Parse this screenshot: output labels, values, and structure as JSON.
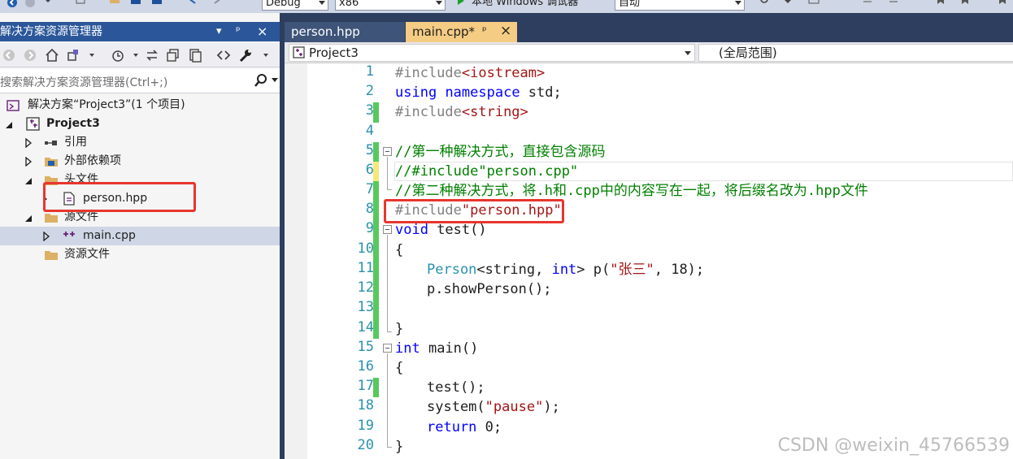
{
  "toolbar": {
    "config": "Debug",
    "platform": "x86",
    "run_label": "本地 Windows 调试器",
    "run_mode": "自动"
  },
  "solution_explorer": {
    "title": "解决方案资源管理器",
    "pin_glyphs": [
      "▾",
      "ᵖ",
      "×"
    ],
    "search_placeholder": "搜索解决方案资源管理器(Ctrl+;)",
    "tree": [
      {
        "label": "解决方案“Project3”(1 个项目)",
        "icon": "solution-icon",
        "expander": "none"
      },
      {
        "label": "Project3",
        "icon": "project-icon",
        "expander": "expanded",
        "bold": true
      },
      {
        "label": "引用",
        "icon": "references-icon",
        "expander": "collapsed"
      },
      {
        "label": "外部依赖项",
        "icon": "external-deps-icon",
        "expander": "collapsed"
      },
      {
        "label": "头文件",
        "icon": "folder-icon",
        "expander": "expanded"
      },
      {
        "label": "person.hpp",
        "icon": "header-file-icon",
        "expander": "collapsed"
      },
      {
        "label": "源文件",
        "icon": "folder-icon",
        "expander": "expanded"
      },
      {
        "label": "main.cpp",
        "icon": "cpp-file-icon",
        "expander": "collapsed",
        "selected": true
      },
      {
        "label": "资源文件",
        "icon": "folder-icon",
        "expander": "none"
      }
    ]
  },
  "editor": {
    "tabs": [
      {
        "label": "person.hpp",
        "active": false
      },
      {
        "label": "main.cpp*",
        "active": true,
        "pin": "ᵖ",
        "close": "×"
      }
    ],
    "nav": {
      "project": "Project3",
      "scope": "(全局范围)"
    },
    "line_numbers": [
      "1",
      "2",
      "3",
      "4",
      "5",
      "6",
      "7",
      "8",
      "9",
      "10",
      "11",
      "12",
      "13",
      "14",
      "15",
      "16",
      "17",
      "18",
      "19",
      "20"
    ],
    "code_text": {
      "l1_a": "#include",
      "l1_b": "<iostream>",
      "l2_a": "using",
      "l2_b": "namespace",
      "l2_c": " std;",
      "l3_a": "#include",
      "l3_b": "<string>",
      "l5": "//第一种解决方式，直接包含源码",
      "l6": "//#include\"person.cpp\"",
      "l7": "//第二种解决方式，将.h和.cpp中的内容写在一起，将后缀名改为.hpp文件",
      "l8_a": "#include",
      "l8_b": "\"person.hpp\"",
      "l9_a": "void",
      "l9_b": " test()",
      "l10": "{",
      "l11_a": "Person",
      "l11_b": "<",
      "l11_c": "string",
      "l11_d": ", ",
      "l11_e": "int",
      "l11_f": "> p(",
      "l11_g": "\"张三\"",
      "l11_h": ", 18);",
      "l12": "p.showPerson();",
      "l14": "}",
      "l15_a": "int",
      "l15_b": " main()",
      "l16": "{",
      "l17": "test();",
      "l18_a": "system(",
      "l18_b": "\"pause\"",
      "l18_c": ");",
      "l19_a": "return",
      "l19_b": " 0;",
      "l20": "}"
    }
  },
  "watermark": "CSDN @weixin_45766539",
  "colors": {
    "highlight_box": "#e8362e",
    "title_bar": "#2b579a",
    "active_tab": "#f5cc84"
  }
}
